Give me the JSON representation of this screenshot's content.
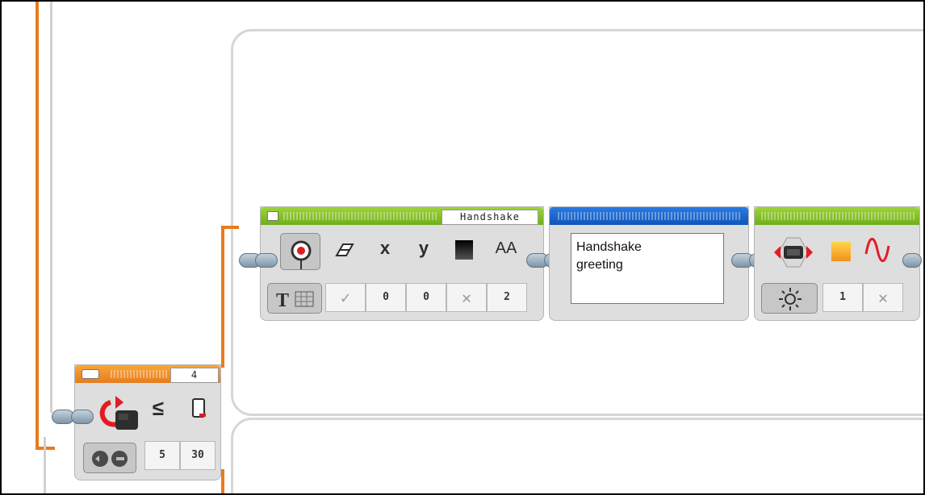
{
  "program": {
    "loop_block": {
      "counter": "4",
      "compare_symbol": "≤",
      "params": [
        "5",
        "30"
      ]
    },
    "display_block": {
      "title": "Handshake",
      "icons": [
        "display-icon",
        "eraser-icon",
        "x-icon",
        "y-icon",
        "color-icon",
        "font-size-icon"
      ],
      "icon_glyphs": {
        "x": "x",
        "y": "y",
        "font": "AA"
      },
      "params": [
        "✓",
        "0",
        "0",
        "✕",
        "2"
      ]
    },
    "text_block": {
      "value": "Handshake\ngreeting"
    },
    "led_block": {
      "icons": [
        "brick-status-light-icon",
        "color-icon",
        "pulse-icon"
      ],
      "params": [
        "1",
        "✕"
      ]
    },
    "colors": {
      "wire": "#e87b1e",
      "green_header": "#7dbb22",
      "blue_header": "#1563c8",
      "orange_header": "#f39a2e"
    }
  }
}
